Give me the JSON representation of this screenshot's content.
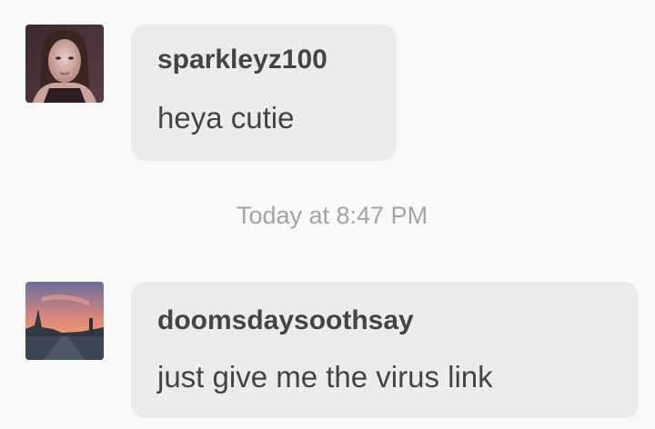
{
  "messages": [
    {
      "username": "sparkleyz100",
      "text": "heya cutie",
      "avatar_icon": "user-photo-avatar"
    },
    {
      "username": "doomsdaysoothsay",
      "text": "just give me the virus link",
      "avatar_icon": "sunset-photo-avatar"
    }
  ],
  "timestamp": "Today at 8:47 PM",
  "colors": {
    "background": "#f9f9f9",
    "bubble": "#ececec",
    "text": "#444444",
    "timestamp": "#a4a4a4"
  }
}
